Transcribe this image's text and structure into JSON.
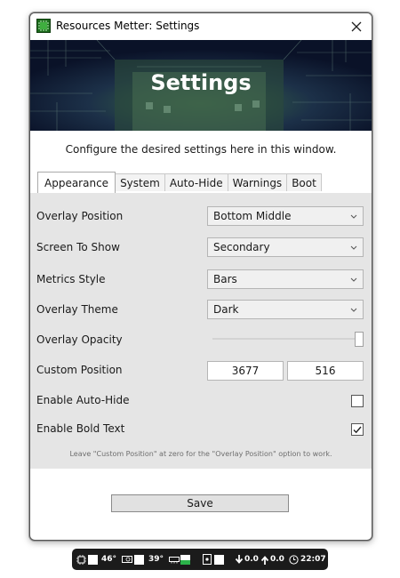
{
  "window": {
    "title": "Resources Metter: Settings",
    "banner_title": "Settings",
    "intro": "Configure the desired settings here in this window."
  },
  "tabs": [
    "Appearance",
    "System",
    "Auto-Hide",
    "Warnings",
    "Boot"
  ],
  "active_tab": "Appearance",
  "settings": {
    "overlay_position": {
      "label": "Overlay Position",
      "value": "Bottom Middle"
    },
    "screen_to_show": {
      "label": "Screen To Show",
      "value": "Secondary"
    },
    "metrics_style": {
      "label": "Metrics Style",
      "value": "Bars"
    },
    "overlay_theme": {
      "label": "Overlay Theme",
      "value": "Dark"
    },
    "overlay_opacity": {
      "label": "Overlay Opacity",
      "value": 1.0
    },
    "custom_position": {
      "label": "Custom Position",
      "x": "3677",
      "y": "516"
    },
    "enable_auto_hide": {
      "label": "Enable Auto-Hide",
      "checked": false
    },
    "enable_bold_text": {
      "label": "Enable Bold Text",
      "checked": true
    }
  },
  "footnote": "Leave \"Custom Position\" at zero for the \"Overlay Position\" option to work.",
  "save_label": "Save",
  "overlay_bar": {
    "cpu_temp": "46°",
    "gpu_temp": "39°",
    "download": "0.0",
    "upload": "0.0",
    "time": "22:07"
  },
  "colors": {
    "banner_bg": "#0c1630",
    "panel_bg": "#e5e5e5",
    "overlay_bg": "#1b1b1b",
    "ram_fill": "#2bb34a"
  }
}
